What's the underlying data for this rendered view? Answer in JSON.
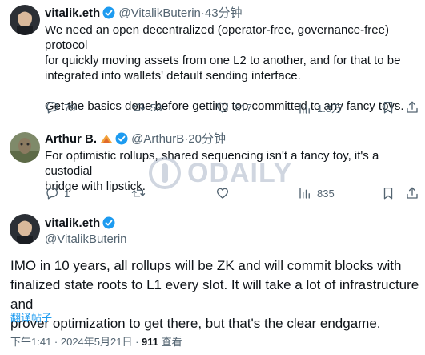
{
  "tweets": [
    {
      "name": "vitalik.eth",
      "handle": "@VitalikButerin",
      "dot": "·",
      "time": "43分钟",
      "body_lines": [
        "We need an open decentralized (operator-free, governance-free) protocol",
        "for quickly moving assets from one L2 to another, and for that to be",
        "integrated into wallets' default sending interface.",
        "",
        "Get the basics done before getting too committed to any fancy toys."
      ],
      "replies": "79",
      "retweets": "53",
      "likes": "317",
      "views": "1.8万"
    },
    {
      "name": "Arthur B.",
      "handle": "@ArthurB",
      "dot": "·",
      "time": "20分钟",
      "body_lines": [
        "For optimistic rollups, shared sequencing isn't a fancy toy, it's a custodial",
        "bridge with lipstick."
      ],
      "replies": "1",
      "views": "835"
    }
  ],
  "main_tweet": {
    "name": "vitalik.eth",
    "handle": "@VitalikButerin",
    "body_lines": [
      "IMO in 10 years, all rollups will be ZK and will commit blocks with",
      "finalized state roots to L1 every slot.  It will take a lot of infrastructure and",
      "prover optimization to get there, but that's the clear endgame."
    ],
    "translate": "翻译帖子",
    "meta_time": "下午1:41 · 2024年5月21日 · ",
    "meta_views": "911",
    "meta_views_label": " 查看"
  },
  "watermark": {
    "text": "ODAILY"
  },
  "colors": {
    "accent": "#1d9bf0",
    "muted": "#536471",
    "text": "#0f1419",
    "thread": "#cfd9de"
  },
  "icons": [
    "verified-badge-icon",
    "reply-icon",
    "retweet-icon",
    "like-icon",
    "views-icon",
    "bookmark-icon",
    "share-icon",
    "emoji-icon"
  ]
}
